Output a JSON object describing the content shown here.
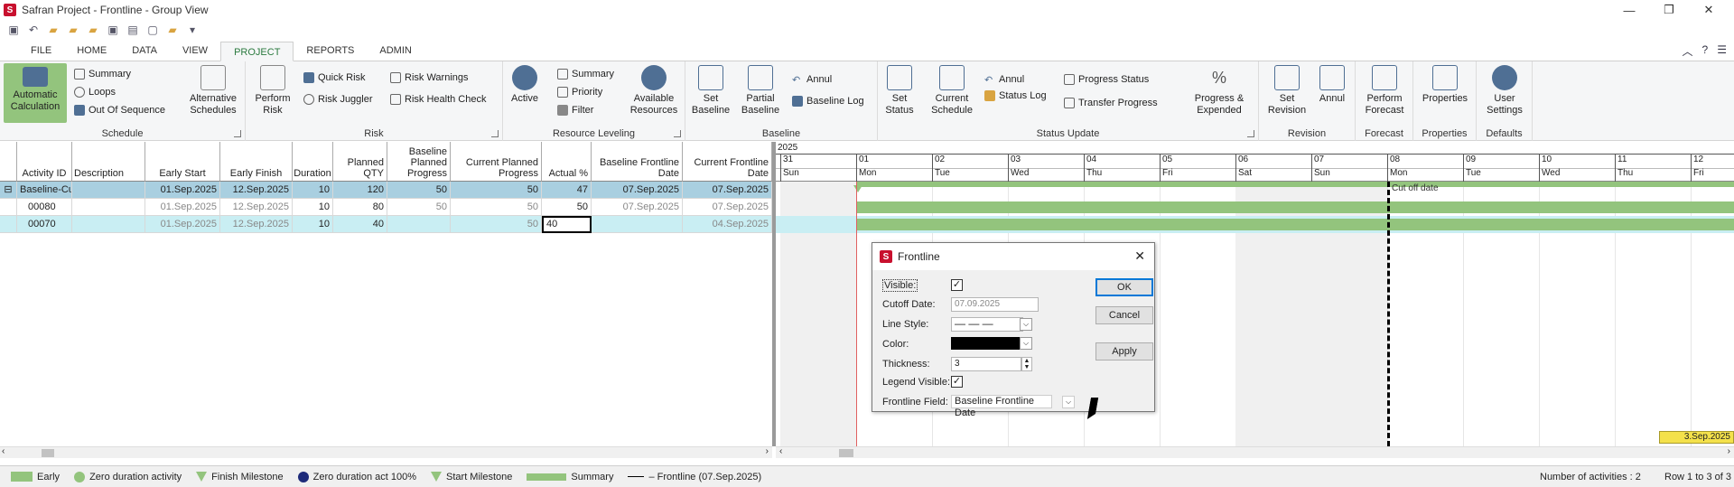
{
  "window": {
    "title": "Safran Project - Frontline - Group View"
  },
  "tabs": [
    "FILE",
    "HOME",
    "DATA",
    "VIEW",
    "PROJECT",
    "REPORTS",
    "ADMIN"
  ],
  "active_tab": "PROJECT",
  "ribbon": {
    "schedule": {
      "label": "Schedule",
      "auto_calc": "Automatic Calculation",
      "summary": "Summary",
      "loops": "Loops",
      "out_of_sequence": "Out Of Sequence",
      "alt_schedules": "Alternative Schedules"
    },
    "risk": {
      "label": "Risk",
      "perform_risk": "Perform Risk",
      "quick_risk": "Quick Risk",
      "risk_juggler": "Risk Juggler",
      "risk_warnings": "Risk Warnings",
      "risk_health": "Risk Health Check"
    },
    "resource_leveling": {
      "label": "Resource Leveling",
      "active": "Active",
      "summary": "Summary",
      "priority": "Priority",
      "filter": "Filter",
      "available": "Available Resources"
    },
    "baseline": {
      "label": "Baseline",
      "set_baseline": "Set Baseline",
      "partial_baseline": "Partial Baseline",
      "annul": "Annul",
      "baseline_log": "Baseline Log"
    },
    "status_update": {
      "label": "Status Update",
      "set_status": "Set Status",
      "current_schedule": "Current Schedule",
      "annul": "Annul",
      "status_log": "Status Log",
      "progress_status": "Progress Status",
      "transfer_progress": "Transfer Progress",
      "progress_expended": "Progress & Expended"
    },
    "revision": {
      "label": "Revision",
      "set_revision": "Set Revision",
      "annul": "Annul"
    },
    "forecast": {
      "label": "Forecast",
      "perform_forecast": "Perform Forecast"
    },
    "properties": {
      "label": "Properties",
      "properties": "Properties"
    },
    "defaults": {
      "label": "Defaults",
      "user_settings": "User Settings"
    }
  },
  "grid": {
    "headers": [
      "Activity ID",
      "Description",
      "Early Start",
      "Early Finish",
      "Duration",
      "Planned QTY",
      "Baseline Planned Progress",
      "Current Planned Progress",
      "Actual %",
      "Baseline Frontline Date",
      "Current Frontline Date"
    ],
    "rows": [
      {
        "id": "Baseline-Cur",
        "desc": "",
        "es": "01.Sep.2025",
        "ef": "12.Sep.2025",
        "dur": "10",
        "qty": "120",
        "bpp": "50",
        "cpp": "50",
        "act": "47",
        "bfd": "07.Sep.2025",
        "cfd": "07.Sep.2025"
      },
      {
        "id": "00080",
        "desc": "",
        "es": "01.Sep.2025",
        "ef": "12.Sep.2025",
        "dur": "10",
        "qty": "80",
        "bpp": "50",
        "cpp": "50",
        "act": "50",
        "bfd": "07.Sep.2025",
        "cfd": "07.Sep.2025"
      },
      {
        "id": "00070",
        "desc": "",
        "es": "01.Sep.2025",
        "ef": "12.Sep.2025",
        "dur": "10",
        "qty": "40",
        "bpp": "",
        "cpp": "50",
        "act": "40",
        "bfd": "",
        "cfd": "04.Sep.2025"
      }
    ]
  },
  "gantt": {
    "year": "2025",
    "days": [
      {
        "n": "31",
        "d": "Sun"
      },
      {
        "n": "01",
        "d": "Mon"
      },
      {
        "n": "02",
        "d": "Tue"
      },
      {
        "n": "03",
        "d": "Wed"
      },
      {
        "n": "04",
        "d": "Thu"
      },
      {
        "n": "05",
        "d": "Fri"
      },
      {
        "n": "06",
        "d": "Sat"
      },
      {
        "n": "07",
        "d": "Sun"
      },
      {
        "n": "08",
        "d": "Mon"
      },
      {
        "n": "09",
        "d": "Tue"
      },
      {
        "n": "10",
        "d": "Wed"
      },
      {
        "n": "11",
        "d": "Thu"
      },
      {
        "n": "12",
        "d": "Fri"
      }
    ],
    "cutoff_label": "Cut off date",
    "date_badge": "3.Sep.2025"
  },
  "dialog": {
    "title": "Frontline",
    "visible_label": "Visible:",
    "cutoff_label": "Cutoff Date:",
    "cutoff_value": "07.09.2025",
    "line_style_label": "Line Style:",
    "color_label": "Color:",
    "thickness_label": "Thickness:",
    "thickness_value": "3",
    "legend_visible_label": "Legend Visible:",
    "frontline_field_label": "Frontline Field:",
    "frontline_field_value": "Baseline Frontline Date",
    "ok": "OK",
    "cancel": "Cancel",
    "apply": "Apply",
    "color_value": "#000000"
  },
  "legend": {
    "early": "Early",
    "zero_dur": "Zero duration activity",
    "finish_ms": "Finish Milestone",
    "zero_dur_100": "Zero duration act 100%",
    "start_ms": "Start Milestone",
    "summary": "Summary",
    "frontline": "– Frontline (07.Sep.2025)",
    "count": "Number of activities : 2",
    "rows": "Row 1 to 3 of 3"
  },
  "colors": {
    "green": "#93c47d",
    "selected_row": "#a9cfe0",
    "current_row": "#c9eef3",
    "accent": "#2b7a3f"
  }
}
